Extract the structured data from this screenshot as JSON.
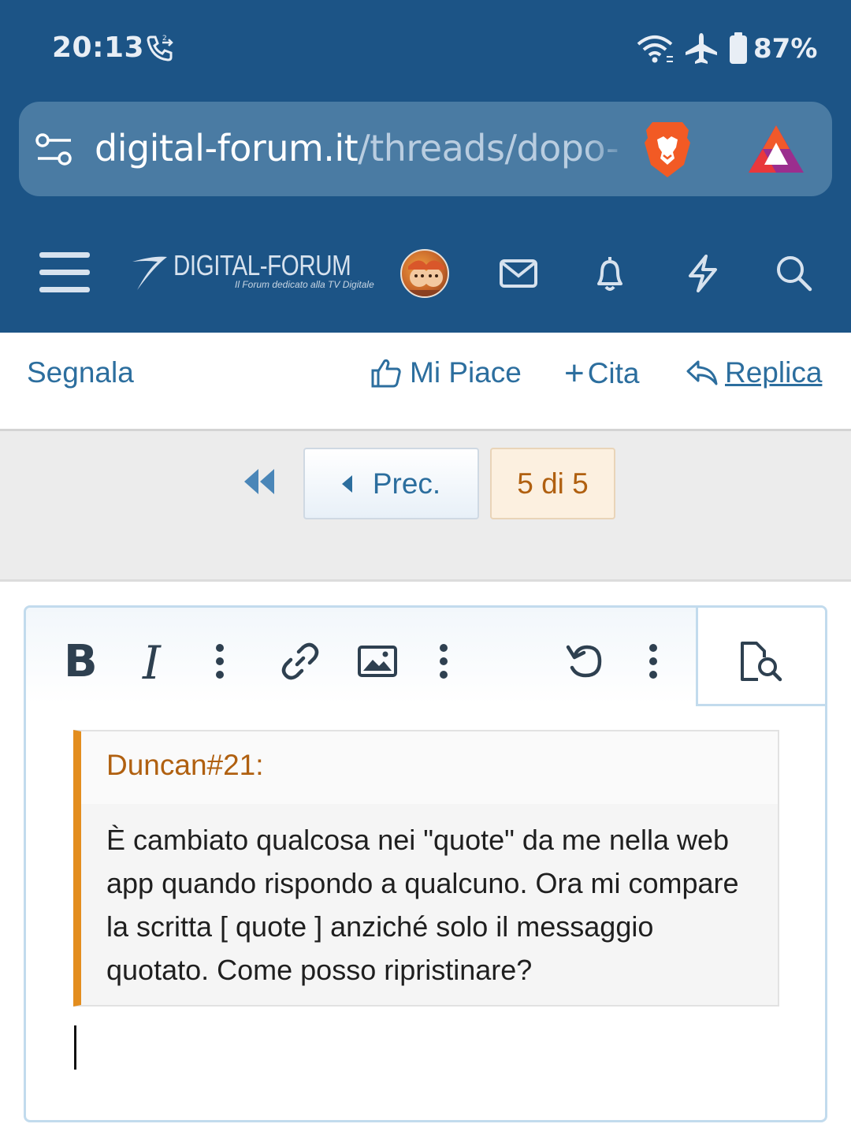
{
  "status_bar": {
    "time": "20:13",
    "battery": "87%",
    "icons": [
      "call-icon",
      "wifi-icon",
      "airplane-icon",
      "battery-icon"
    ]
  },
  "browser": {
    "url_host": "digital-forum.it",
    "url_path": "/threads/dopo-la",
    "icons": [
      "tune-icon",
      "brave-lion-icon",
      "bat-triangle-icon"
    ]
  },
  "site_nav": {
    "logo_title": "DIGITAL-FORUM",
    "logo_subtitle": "Il Forum dedicato alla TV Digitale",
    "icons": [
      "menu-icon",
      "avatar",
      "mail-icon",
      "bell-icon",
      "bolt-icon",
      "search-icon"
    ]
  },
  "post_actions": {
    "report": "Segnala",
    "like": "Mi Piace",
    "quote": "Cita",
    "reply": "Replica"
  },
  "pagination": {
    "prev": "Prec.",
    "page_count": "5 di 5"
  },
  "editor": {
    "toolbar": {
      "bold": "B",
      "italic": "I"
    },
    "quote": {
      "author": "Duncan#21:",
      "text": "È cambiato qualcosa nei \"quote\" da me nella web app quando rispondo a qualcuno. Ora mi compare la scritta [ quote ] anziché solo il messaggio quotato. Come posso ripristinare?"
    }
  },
  "colors": {
    "header_bg": "#1c5486",
    "link": "#2c6e9e",
    "quote_accent": "#e38d1e",
    "quote_author": "#b06010"
  }
}
